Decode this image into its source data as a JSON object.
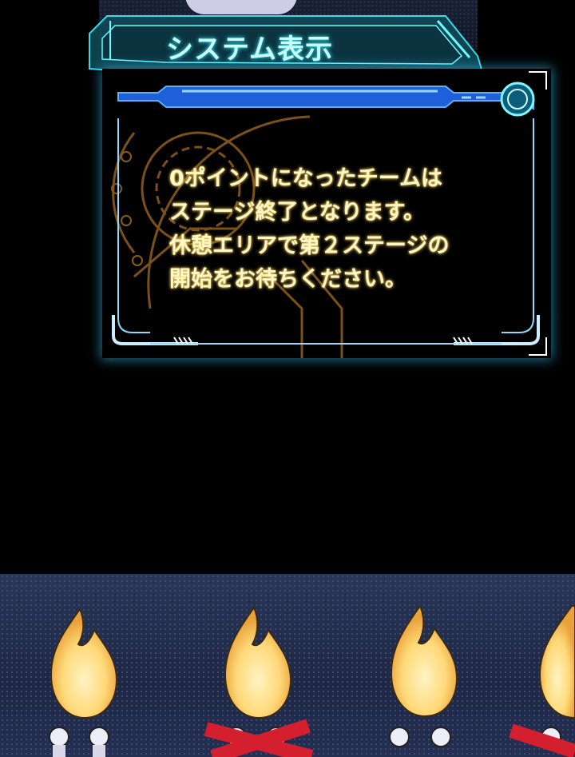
{
  "system_window": {
    "title": "システム表示",
    "message_lines": [
      "0ポイントになったチームは",
      "ステージ終了となります。",
      "休憩エリアで第２ステージの",
      "開始をお待ちください。"
    ]
  },
  "colors": {
    "title_glow": "#3ff0ff",
    "frame_blue": "#1f7bff",
    "message_text": "#fff7c8",
    "circuit_orange": "#8a5a1c",
    "flame": "#ffd978",
    "cross_mark": "#d4202e"
  },
  "scene": {
    "flame_count": 4,
    "crossed_out_count": 2
  }
}
